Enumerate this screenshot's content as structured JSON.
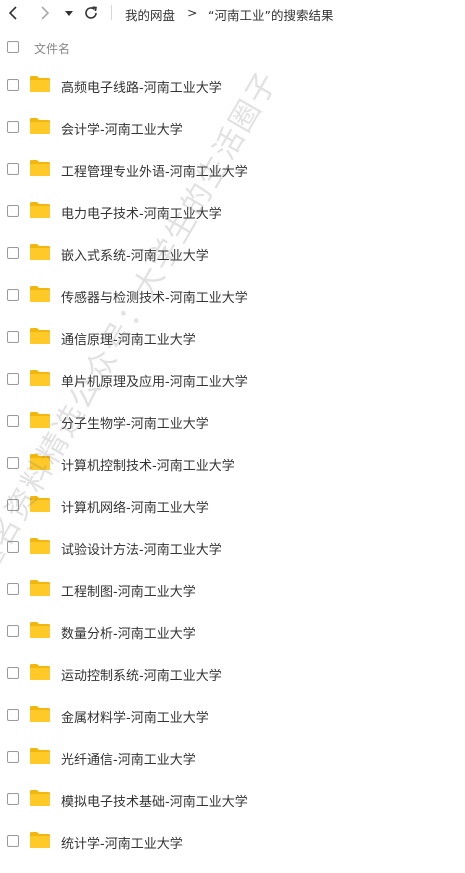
{
  "nav": {
    "back_icon": "chevron-left-icon",
    "forward_icon": "chevron-right-icon",
    "dropdown_icon": "caret-down-icon",
    "refresh_icon": "refresh-icon"
  },
  "breadcrumb": {
    "root": "我的网盘",
    "separator": ">",
    "current": "“河南工业”的搜索结果"
  },
  "table": {
    "header_label": "文件名"
  },
  "files": [
    {
      "name": "高频电子线路-河南工业大学"
    },
    {
      "name": "会计学-河南工业大学"
    },
    {
      "name": "工程管理专业外语-河南工业大学"
    },
    {
      "name": "电力电子技术-河南工业大学"
    },
    {
      "name": "嵌入式系统-河南工业大学"
    },
    {
      "name": "传感器与检测技术-河南工业大学"
    },
    {
      "name": "通信原理-河南工业大学"
    },
    {
      "name": "单片机原理及应用-河南工业大学"
    },
    {
      "name": "分子生物学-河南工业大学"
    },
    {
      "name": "计算机控制技术-河南工业大学"
    },
    {
      "name": "计算机网络-河南工业大学"
    },
    {
      "name": "试验设计方法-河南工业大学"
    },
    {
      "name": "工程制图-河南工业大学"
    },
    {
      "name": "数量分析-河南工业大学"
    },
    {
      "name": "运动控制系统-河南工业大学"
    },
    {
      "name": "金属材料学-河南工业大学"
    },
    {
      "name": "光纤通信-河南工业大学"
    },
    {
      "name": "模拟电子技术基础-河南工业大学"
    },
    {
      "name": "统计学-河南工业大学"
    }
  ],
  "watermark": "题名资料精选公众号：大学生的生活圈子",
  "colors": {
    "folder": "#FFC928",
    "folder_tab": "#F2B70F",
    "text": "#333333",
    "muted": "#888888"
  }
}
